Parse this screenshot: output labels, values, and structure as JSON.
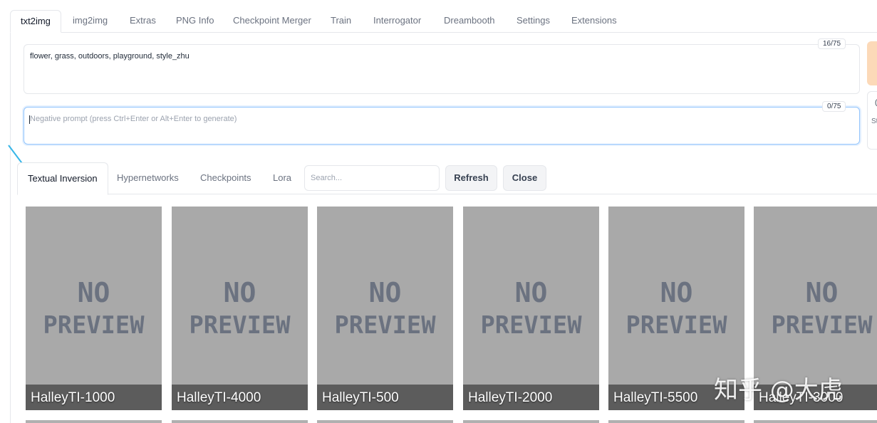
{
  "top_tabs": [
    "txt2img",
    "img2img",
    "Extras",
    "PNG Info",
    "Checkpoint Merger",
    "Train",
    "Interrogator",
    "Dreambooth",
    "Settings",
    "Extensions"
  ],
  "prompt": {
    "value": "flower, grass, outdoors, playground, style_zhu",
    "token_count": "16/75"
  },
  "negative_prompt": {
    "placeholder": "Negative prompt (press Ctrl+Enter or Alt+Enter to generate)",
    "token_count": "0/75"
  },
  "right_partial": {
    "frag1": "(",
    "frag2": "St"
  },
  "extra_networks": {
    "tabs": [
      "Textual Inversion",
      "Hypernetworks",
      "Checkpoints",
      "Lora"
    ],
    "search_placeholder": "Search...",
    "refresh_label": "Refresh",
    "close_label": "Close",
    "cards": [
      {
        "name": "HalleyTI-1000",
        "preview_text": [
          "NO",
          "PREVIEW"
        ]
      },
      {
        "name": "HalleyTI-4000",
        "preview_text": [
          "NO",
          "PREVIEW"
        ]
      },
      {
        "name": "HalleyTI-500",
        "preview_text": [
          "NO",
          "PREVIEW"
        ]
      },
      {
        "name": "HalleyTI-2000",
        "preview_text": [
          "NO",
          "PREVIEW"
        ]
      },
      {
        "name": "HalleyTI-5500",
        "preview_text": [
          "NO",
          "PREVIEW"
        ]
      },
      {
        "name": "HalleyTI-3000",
        "preview_text": [
          "NO",
          "PREVIEW"
        ]
      }
    ]
  },
  "annotation_arrow_icon": "arrow-pointer-icon",
  "watermark": "知乎 @大虎",
  "colors": {
    "active_text": "#111827",
    "inactive_text": "#6b7280",
    "border": "#e5e7eb",
    "card_bg": "#a9a9a9",
    "preview_text": "#6b7280",
    "focus_ring": "#93c5fd",
    "generate_button": "#fcd9b8",
    "arrow": "#38b6e8"
  }
}
